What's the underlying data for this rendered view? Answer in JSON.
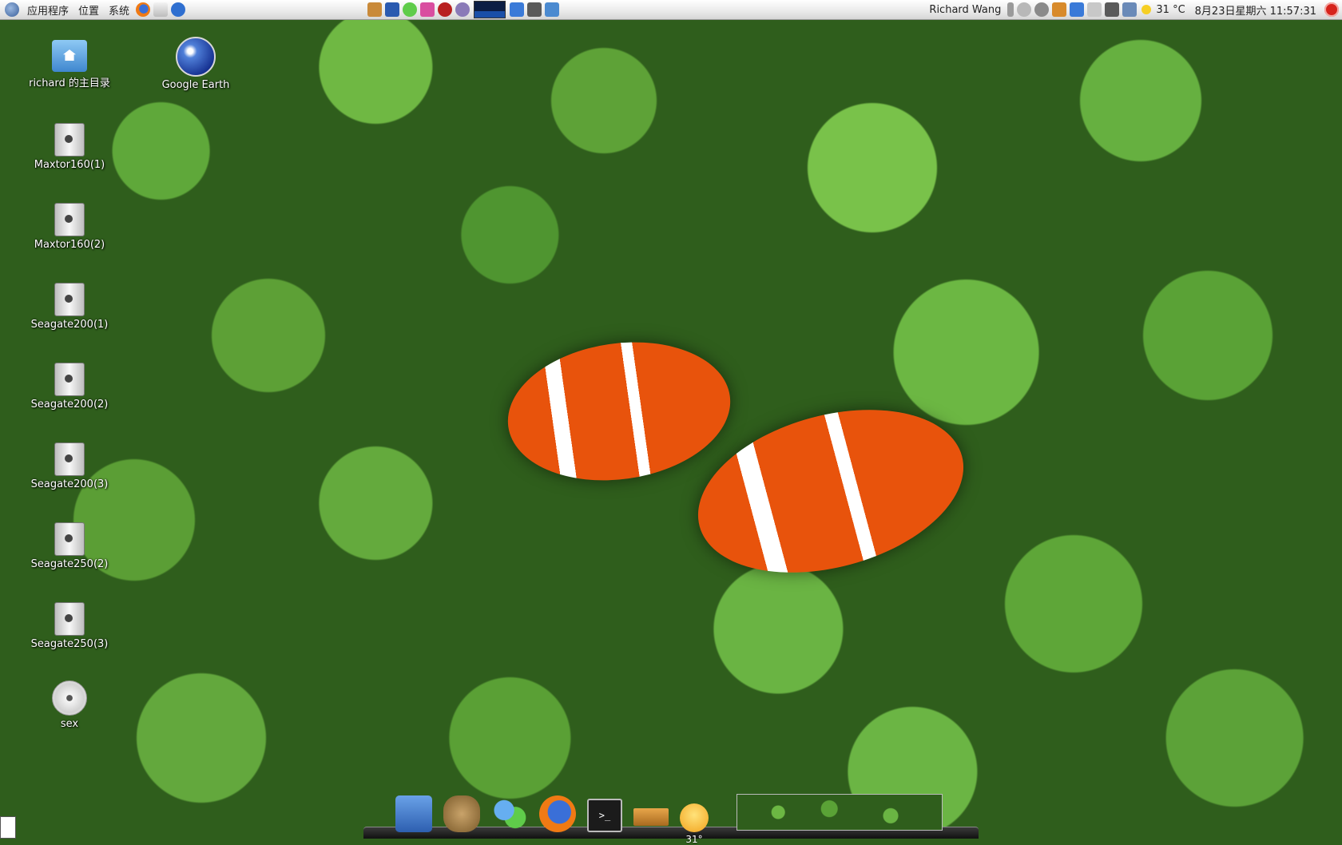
{
  "top_panel": {
    "menus": [
      "应用程序",
      "位置",
      "系统"
    ],
    "user_name": "Richard Wang",
    "weather_temp": "31 °C",
    "clock": "8月23日星期六 11:57:31"
  },
  "desktop_icons": [
    {
      "label": "richard 的主目录",
      "icon": "home-folder-icon"
    },
    {
      "label": "Google Earth",
      "icon": "google-earth-icon"
    },
    {
      "label": "Maxtor160(1)",
      "icon": "hard-drive-icon"
    },
    {
      "label": "Maxtor160(2)",
      "icon": "hard-drive-icon"
    },
    {
      "label": "Seagate200(1)",
      "icon": "hard-drive-icon"
    },
    {
      "label": "Seagate200(2)",
      "icon": "hard-drive-icon"
    },
    {
      "label": "Seagate200(3)",
      "icon": "hard-drive-icon"
    },
    {
      "label": "Seagate250(2)",
      "icon": "hard-drive-icon"
    },
    {
      "label": "Seagate250(3)",
      "icon": "hard-drive-icon"
    },
    {
      "label": "sex",
      "icon": "optical-disc-icon"
    }
  ],
  "dock": {
    "weather_label": "31°",
    "terminal_glyph": ">_"
  },
  "colors": {
    "panel_bg": "#e9e9e9",
    "desktop_green": "#5ea237",
    "fish_orange": "#e8530c"
  }
}
